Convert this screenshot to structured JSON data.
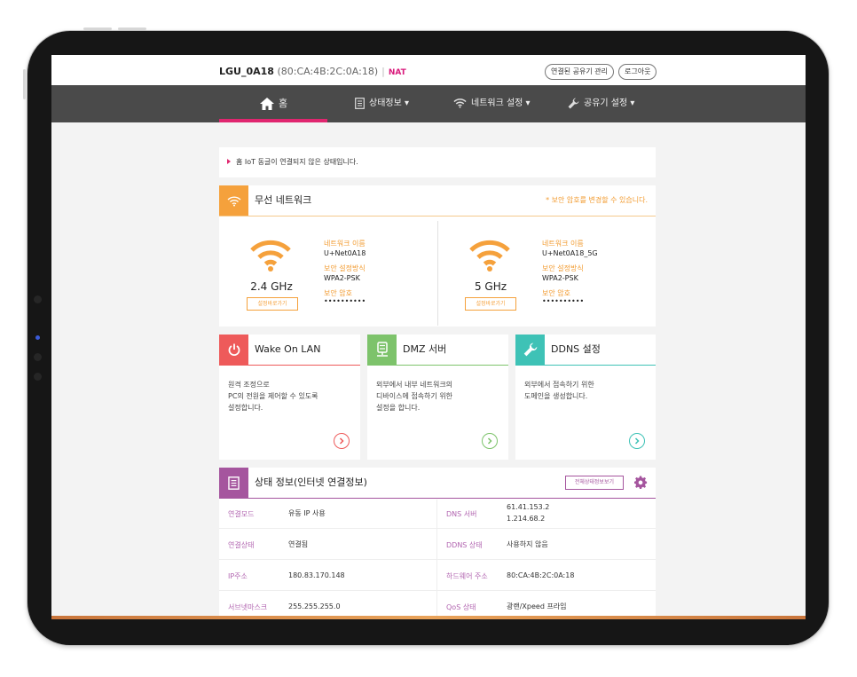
{
  "topbar": {
    "ssid": "LGU_0A18",
    "mac": "(80:CA:4B:2C:0A:18)",
    "separator": "|",
    "mode": "NAT",
    "manage_button": "연결된 공유기 관리",
    "logout_button": "로그아웃"
  },
  "nav": {
    "items": [
      {
        "label": "홈",
        "icon": "home-icon"
      },
      {
        "label": "상태정보 ▾",
        "icon": "document-icon"
      },
      {
        "label": "네트워크 설정 ▾",
        "icon": "wifi-icon"
      },
      {
        "label": "공유기 설정 ▾",
        "icon": "wrench-icon"
      }
    ],
    "active_color": "#e0266f"
  },
  "notice": {
    "text": "홈 IoT 동글이 연결되지 않은 상태입니다."
  },
  "wireless": {
    "title": "무선 네트워크",
    "note": "* 보안 암호를 변경할 수 있습니다.",
    "accent": "#f5a13c",
    "bands": [
      {
        "band": "2.4 GHz",
        "button": "설정바로가기",
        "name_label": "네트워크 이름",
        "name": "U+Net0A18",
        "sec_label": "보안 설정방식",
        "security": "WPA2-PSK",
        "pw_label": "보안 암호",
        "password": "••••••••••"
      },
      {
        "band": "5 GHz",
        "button": "설정바로가기",
        "name_label": "네트워크 이름",
        "name": "U+Net0A18_5G",
        "sec_label": "보안 설정방식",
        "security": "WPA2-PSK",
        "pw_label": "보안 암호",
        "password": "••••••••••"
      }
    ]
  },
  "features": [
    {
      "title": "Wake On LAN",
      "desc": "원격 조정으로\nPC의 전원을 제어할 수 있도록\n설정합니다.",
      "color": "#ee5a5a",
      "icon": "power-icon"
    },
    {
      "title": "DMZ 서버",
      "desc": "외부에서 내부 네트워크의\n디바이스에 접속하기 위한\n설정을 합니다.",
      "color": "#7dc36b",
      "icon": "server-icon"
    },
    {
      "title": "DDNS 설정",
      "desc": "외부에서 접속하기 위한\n도메인을 생성합니다.",
      "color": "#3ec2b6",
      "icon": "wrench-icon"
    }
  ],
  "status": {
    "title": "상태 정보(인터넷 연결정보)",
    "detail_button": "전체상태정보보기",
    "accent": "#a5559e",
    "left": [
      {
        "label": "연결모드",
        "value": "유동 IP 사용"
      },
      {
        "label": "연결상태",
        "value": "연결됨"
      },
      {
        "label": "IP주소",
        "value": "180.83.170.148"
      },
      {
        "label": "서브넷마스크",
        "value": "255.255.255.0"
      }
    ],
    "right": [
      {
        "label": "DNS 서버",
        "value": "61.41.153.2",
        "value2": "1.214.68.2"
      },
      {
        "label": "DDNS 상태",
        "value": "사용하지 않음"
      },
      {
        "label": "하드웨어 주소",
        "value": "80:CA:4B:2C:0A:18"
      },
      {
        "label": "QoS 상태",
        "value": "광랜/Xpeed 프라임"
      }
    ]
  }
}
